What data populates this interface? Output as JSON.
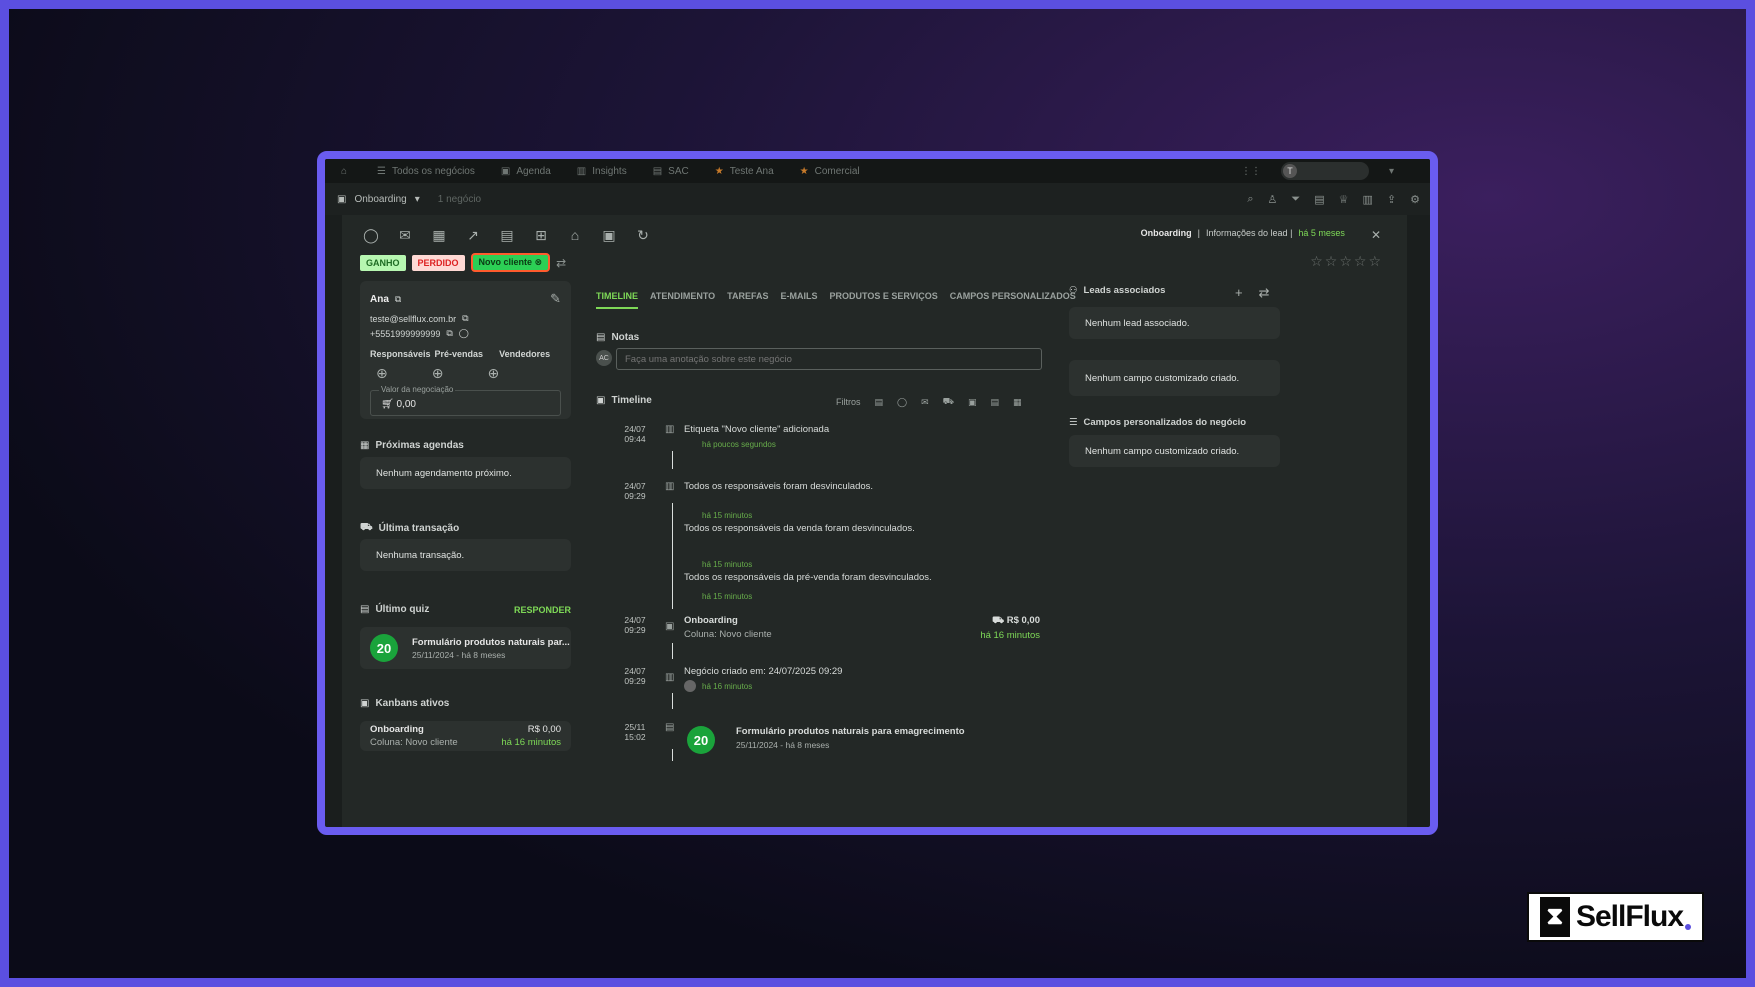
{
  "nav": {
    "items": [
      {
        "label": "Todos os negócios",
        "icon": "list-icon"
      },
      {
        "label": "Agenda",
        "icon": "calendar-icon"
      },
      {
        "label": "Insights",
        "icon": "chart-icon"
      },
      {
        "label": "SAC",
        "icon": "chat-icon"
      },
      {
        "label": "Teste Ana",
        "icon": "star-icon"
      },
      {
        "label": "Comercial",
        "icon": "star-icon"
      }
    ],
    "avatar_initial": "T"
  },
  "subbar": {
    "pipeline": "Onboarding",
    "count": "1 negócio"
  },
  "header": {
    "pipeline": "Onboarding",
    "separator": "|",
    "info_label": "Informações do lead |",
    "time": "há 5 meses",
    "close": "✕"
  },
  "tags": {
    "win": "GANHO",
    "lost": "PERDIDO",
    "status": "Novo cliente"
  },
  "contact": {
    "name": "Ana",
    "email": "teste@sellflux.com.br",
    "phone": "+5551999999999",
    "roles": [
      "Responsáveis",
      "Pré-vendas",
      "Vendedores"
    ],
    "value_label": "Valor da negociação",
    "value": "0,00"
  },
  "agenda": {
    "title": "Próximas agendas",
    "empty": "Nenhum agendamento próximo."
  },
  "transaction": {
    "title": "Última transação",
    "empty": "Nenhuma transação."
  },
  "quiz": {
    "title": "Último quiz",
    "action": "RESPONDER",
    "score": "20",
    "name": "Formulário produtos naturais par...",
    "date": "25/11/2024 - há 8 meses"
  },
  "kanbans": {
    "title": "Kanbans ativos",
    "name": "Onboarding",
    "value": "R$ 0,00",
    "column": "Coluna: Novo cliente",
    "time": "há 16 minutos"
  },
  "tabs": [
    "TIMELINE",
    "ATENDIMENTO",
    "TAREFAS",
    "E-MAILS",
    "PRODUTOS E SERVIÇOS",
    "CAMPOS PERSONALIZADOS"
  ],
  "notes": {
    "title": "Notas",
    "avatar": "AC",
    "placeholder": "Faça uma anotação sobre este negócio"
  },
  "timeline": {
    "title": "Timeline",
    "filters_label": "Filtros",
    "events": [
      {
        "day": "24/07",
        "time": "09:44",
        "text": "Etiqueta \"Novo cliente\" adicionada",
        "sub": "há poucos segundos"
      },
      {
        "day": "24/07",
        "time": "09:29",
        "text": "Todos os responsáveis foram desvinculados.",
        "sub": "há 15 minutos"
      },
      {
        "text": "Todos os responsáveis da venda foram desvinculados.",
        "sub": "há 15 minutos"
      },
      {
        "text": "Todos os responsáveis da pré-venda foram desvinculados.",
        "sub": "há 15 minutos"
      },
      {
        "day": "24/07",
        "time": "09:29",
        "text": "Onboarding",
        "sub": "Coluna: Novo cliente",
        "value": "R$ 0,00",
        "value_time": "há 16 minutos"
      },
      {
        "day": "24/07",
        "time": "09:29",
        "text": "Negócio criado em: 24/07/2025 09:29",
        "sub": "há 16 minutos"
      },
      {
        "day": "25/11",
        "time": "15:02",
        "score": "20",
        "text": "Formulário produtos naturais para emagrecimento",
        "sub": "25/11/2024 - há 8 meses"
      }
    ]
  },
  "right": {
    "leads_title": "Leads associados",
    "leads_empty": "Nenhum lead associado.",
    "custom_empty": "Nenhum campo customizado criado.",
    "deal_fields_title": "Campos personalizados do negócio",
    "deal_fields_empty": "Nenhum campo customizado criado."
  },
  "logo": {
    "text": "SellFlux"
  }
}
